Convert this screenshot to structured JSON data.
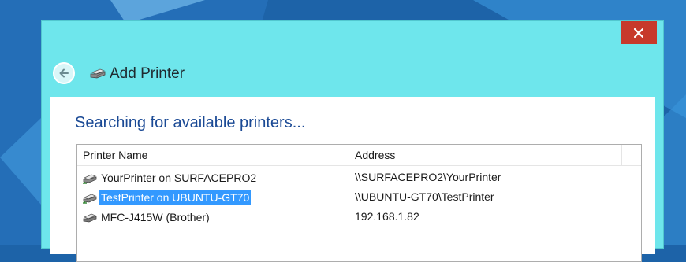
{
  "window": {
    "title": "Add Printer"
  },
  "main": {
    "heading": "Searching for available printers..."
  },
  "table": {
    "columns": [
      "Printer Name",
      "Address"
    ],
    "rows": [
      {
        "name": "YourPrinter on SURFACEPRO2",
        "address": "\\\\SURFACEPRO2\\YourPrinter",
        "selected": false,
        "icon": "network-printer-icon"
      },
      {
        "name": "TestPrinter on UBUNTU-GT70",
        "address": "\\\\UBUNTU-GT70\\TestPrinter",
        "selected": true,
        "icon": "network-printer-icon"
      },
      {
        "name": "MFC-J415W (Brother)",
        "address": "192.168.1.82",
        "selected": false,
        "icon": "printer-icon"
      }
    ]
  },
  "colors": {
    "title_bar": "#6ee6ec",
    "close_button": "#c7392b",
    "heading_text": "#1b4a95",
    "selection": "#3399ff"
  }
}
